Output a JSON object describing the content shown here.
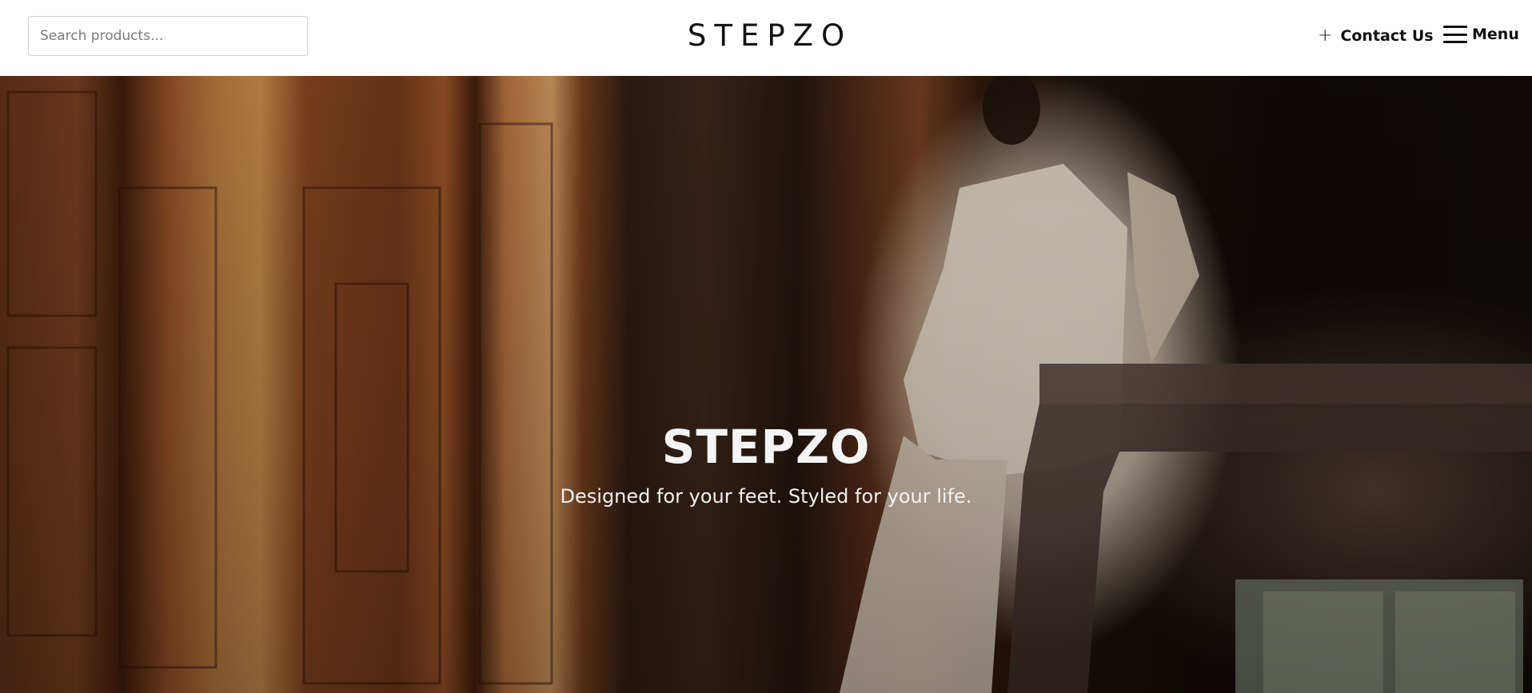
{
  "header": {
    "search": {
      "placeholder": "Search products...",
      "value": ""
    },
    "logo": "STEPZO",
    "contact": {
      "icon": "plus-icon",
      "label": "Contact Us"
    },
    "menu": {
      "icon": "hamburger-icon",
      "label": "Menu"
    }
  },
  "hero": {
    "title": "STEPZO",
    "tagline": "Designed for your feet. Styled for your life."
  }
}
